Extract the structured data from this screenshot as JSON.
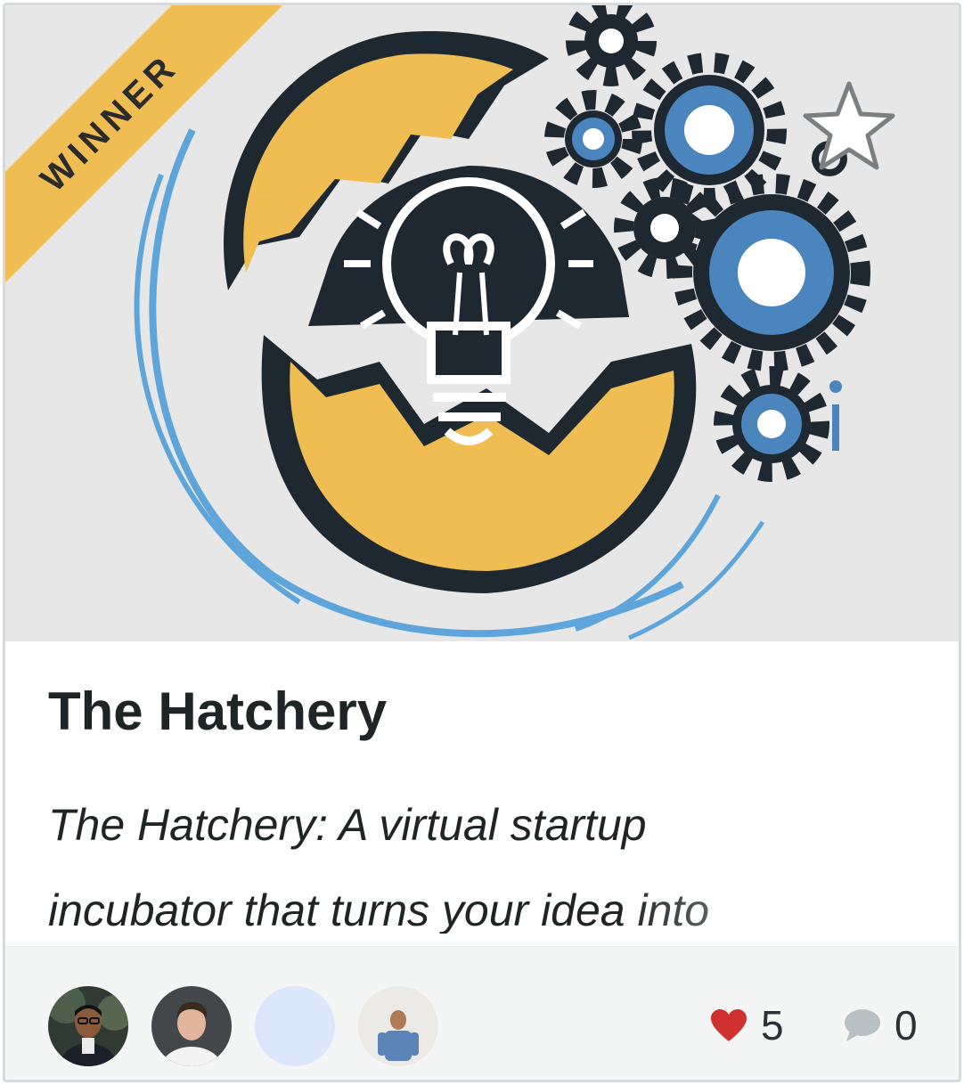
{
  "badge": {
    "label": "WINNER"
  },
  "project": {
    "title": "The Hatchery",
    "tagline_line1": "The Hatchery: A virtual startup",
    "tagline_line2": "incubator that turns your idea into"
  },
  "stats": {
    "likes": "5",
    "comments": "0"
  },
  "colors": {
    "accent": "#f0bd52",
    "heart": "#d0302f",
    "blue": "#4a86bd",
    "dark": "#1e2830"
  }
}
